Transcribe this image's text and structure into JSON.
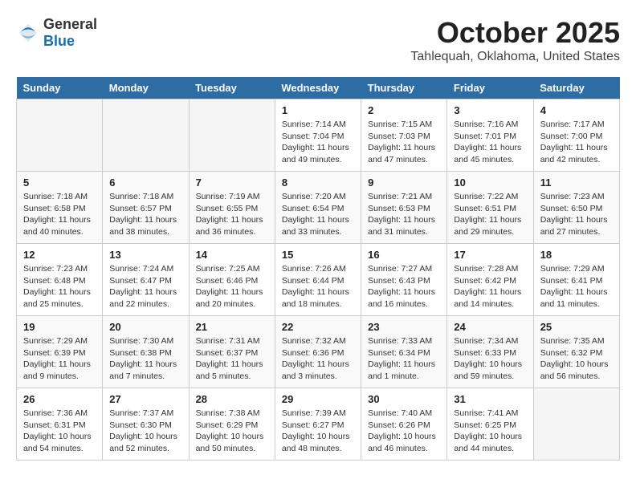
{
  "header": {
    "logo_general": "General",
    "logo_blue": "Blue",
    "month_year": "October 2025",
    "location": "Tahlequah, Oklahoma, United States"
  },
  "days_of_week": [
    "Sunday",
    "Monday",
    "Tuesday",
    "Wednesday",
    "Thursday",
    "Friday",
    "Saturday"
  ],
  "weeks": [
    [
      {
        "day": "",
        "info": ""
      },
      {
        "day": "",
        "info": ""
      },
      {
        "day": "",
        "info": ""
      },
      {
        "day": "1",
        "info": "Sunrise: 7:14 AM\nSunset: 7:04 PM\nDaylight: 11 hours\nand 49 minutes."
      },
      {
        "day": "2",
        "info": "Sunrise: 7:15 AM\nSunset: 7:03 PM\nDaylight: 11 hours\nand 47 minutes."
      },
      {
        "day": "3",
        "info": "Sunrise: 7:16 AM\nSunset: 7:01 PM\nDaylight: 11 hours\nand 45 minutes."
      },
      {
        "day": "4",
        "info": "Sunrise: 7:17 AM\nSunset: 7:00 PM\nDaylight: 11 hours\nand 42 minutes."
      }
    ],
    [
      {
        "day": "5",
        "info": "Sunrise: 7:18 AM\nSunset: 6:58 PM\nDaylight: 11 hours\nand 40 minutes."
      },
      {
        "day": "6",
        "info": "Sunrise: 7:18 AM\nSunset: 6:57 PM\nDaylight: 11 hours\nand 38 minutes."
      },
      {
        "day": "7",
        "info": "Sunrise: 7:19 AM\nSunset: 6:55 PM\nDaylight: 11 hours\nand 36 minutes."
      },
      {
        "day": "8",
        "info": "Sunrise: 7:20 AM\nSunset: 6:54 PM\nDaylight: 11 hours\nand 33 minutes."
      },
      {
        "day": "9",
        "info": "Sunrise: 7:21 AM\nSunset: 6:53 PM\nDaylight: 11 hours\nand 31 minutes."
      },
      {
        "day": "10",
        "info": "Sunrise: 7:22 AM\nSunset: 6:51 PM\nDaylight: 11 hours\nand 29 minutes."
      },
      {
        "day": "11",
        "info": "Sunrise: 7:23 AM\nSunset: 6:50 PM\nDaylight: 11 hours\nand 27 minutes."
      }
    ],
    [
      {
        "day": "12",
        "info": "Sunrise: 7:23 AM\nSunset: 6:48 PM\nDaylight: 11 hours\nand 25 minutes."
      },
      {
        "day": "13",
        "info": "Sunrise: 7:24 AM\nSunset: 6:47 PM\nDaylight: 11 hours\nand 22 minutes."
      },
      {
        "day": "14",
        "info": "Sunrise: 7:25 AM\nSunset: 6:46 PM\nDaylight: 11 hours\nand 20 minutes."
      },
      {
        "day": "15",
        "info": "Sunrise: 7:26 AM\nSunset: 6:44 PM\nDaylight: 11 hours\nand 18 minutes."
      },
      {
        "day": "16",
        "info": "Sunrise: 7:27 AM\nSunset: 6:43 PM\nDaylight: 11 hours\nand 16 minutes."
      },
      {
        "day": "17",
        "info": "Sunrise: 7:28 AM\nSunset: 6:42 PM\nDaylight: 11 hours\nand 14 minutes."
      },
      {
        "day": "18",
        "info": "Sunrise: 7:29 AM\nSunset: 6:41 PM\nDaylight: 11 hours\nand 11 minutes."
      }
    ],
    [
      {
        "day": "19",
        "info": "Sunrise: 7:29 AM\nSunset: 6:39 PM\nDaylight: 11 hours\nand 9 minutes."
      },
      {
        "day": "20",
        "info": "Sunrise: 7:30 AM\nSunset: 6:38 PM\nDaylight: 11 hours\nand 7 minutes."
      },
      {
        "day": "21",
        "info": "Sunrise: 7:31 AM\nSunset: 6:37 PM\nDaylight: 11 hours\nand 5 minutes."
      },
      {
        "day": "22",
        "info": "Sunrise: 7:32 AM\nSunset: 6:36 PM\nDaylight: 11 hours\nand 3 minutes."
      },
      {
        "day": "23",
        "info": "Sunrise: 7:33 AM\nSunset: 6:34 PM\nDaylight: 11 hours\nand 1 minute."
      },
      {
        "day": "24",
        "info": "Sunrise: 7:34 AM\nSunset: 6:33 PM\nDaylight: 10 hours\nand 59 minutes."
      },
      {
        "day": "25",
        "info": "Sunrise: 7:35 AM\nSunset: 6:32 PM\nDaylight: 10 hours\nand 56 minutes."
      }
    ],
    [
      {
        "day": "26",
        "info": "Sunrise: 7:36 AM\nSunset: 6:31 PM\nDaylight: 10 hours\nand 54 minutes."
      },
      {
        "day": "27",
        "info": "Sunrise: 7:37 AM\nSunset: 6:30 PM\nDaylight: 10 hours\nand 52 minutes."
      },
      {
        "day": "28",
        "info": "Sunrise: 7:38 AM\nSunset: 6:29 PM\nDaylight: 10 hours\nand 50 minutes."
      },
      {
        "day": "29",
        "info": "Sunrise: 7:39 AM\nSunset: 6:27 PM\nDaylight: 10 hours\nand 48 minutes."
      },
      {
        "day": "30",
        "info": "Sunrise: 7:40 AM\nSunset: 6:26 PM\nDaylight: 10 hours\nand 46 minutes."
      },
      {
        "day": "31",
        "info": "Sunrise: 7:41 AM\nSunset: 6:25 PM\nDaylight: 10 hours\nand 44 minutes."
      },
      {
        "day": "",
        "info": ""
      }
    ]
  ]
}
